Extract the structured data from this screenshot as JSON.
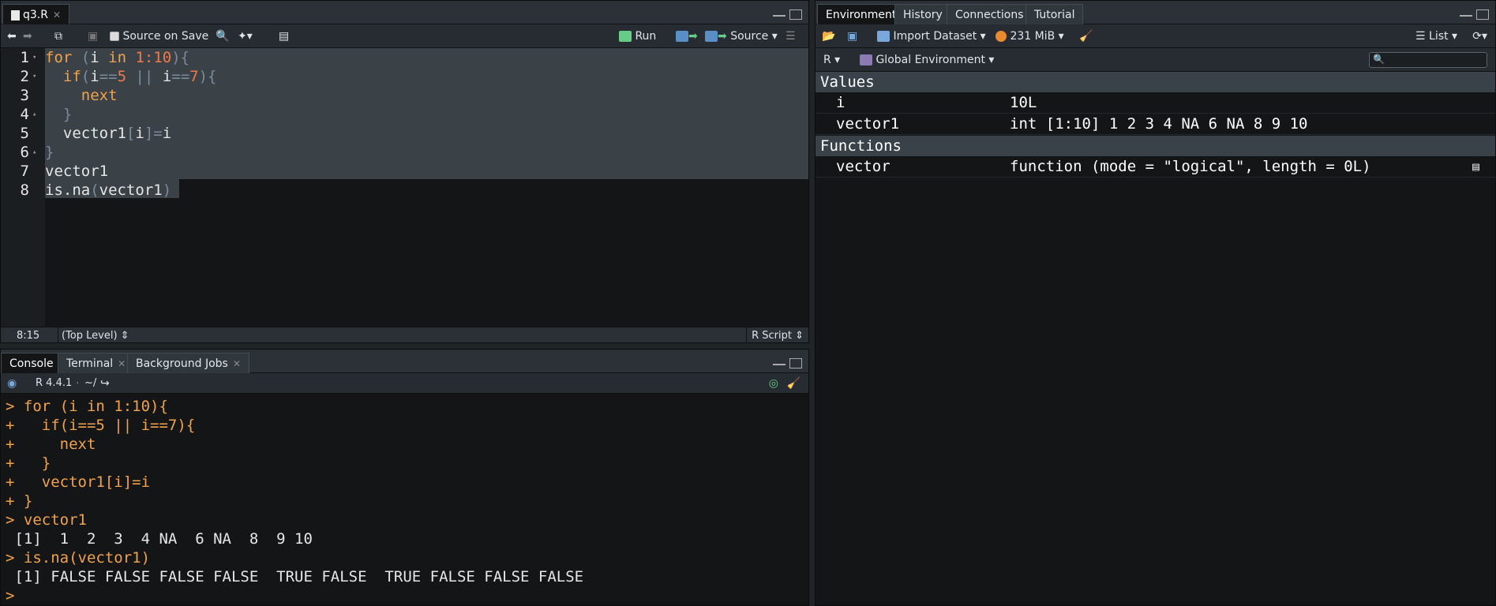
{
  "editor": {
    "tab": "q3.R",
    "toolbar": {
      "source_on_save": "Source on Save",
      "run": "Run",
      "source": "Source"
    },
    "lines": [
      "1",
      "2",
      "3",
      "4",
      "5",
      "6",
      "7",
      "8"
    ],
    "status": {
      "position": "8:15",
      "scope": "(Top Level)",
      "filetype": "R Script"
    }
  },
  "console": {
    "tabs": [
      "Console",
      "Terminal",
      "Background Jobs"
    ],
    "version": "R 4.4.1",
    "path": "~/",
    "lines": [
      "> for (i in 1:10){",
      "+   if(i==5 || i==7){",
      "+     next",
      "+   }",
      "+   vector1[i]=i",
      "+ }",
      "> vector1",
      " [1]  1  2  3  4 NA  6 NA  8  9 10",
      "> is.na(vector1)",
      " [1] FALSE FALSE FALSE FALSE  TRUE FALSE  TRUE FALSE FALSE FALSE",
      "> "
    ]
  },
  "environment": {
    "tabs": [
      "Environment",
      "History",
      "Connections",
      "Tutorial"
    ],
    "toolbar": {
      "import": "Import Dataset",
      "memory": "231 MiB",
      "view": "List",
      "lang": "R",
      "scope": "Global Environment"
    },
    "values_header": "Values",
    "values": [
      {
        "name": "i",
        "value": "10L"
      },
      {
        "name": "vector1",
        "value": "int [1:10] 1 2 3 4 NA 6 NA 8 9 10"
      }
    ],
    "functions_header": "Functions",
    "functions": [
      {
        "name": "vector",
        "value": "function (mode = \"logical\", length = 0L)"
      }
    ]
  },
  "colors": {
    "keyword": "#f2a24a",
    "number": "#f27a4a",
    "prompt": "#f2a24a",
    "selection": "#3a4147"
  }
}
